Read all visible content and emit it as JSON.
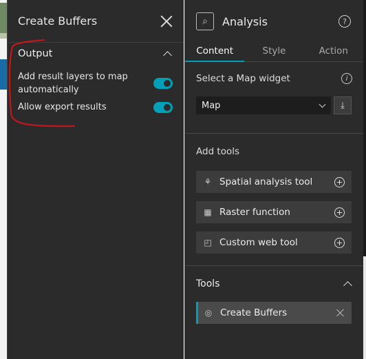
{
  "left_panel": {
    "title": "Create Buffers",
    "output_section": {
      "title": "Output",
      "options": [
        {
          "label": "Add result layers to map automatically",
          "enabled": true
        },
        {
          "label": "Allow export results",
          "enabled": true
        }
      ]
    }
  },
  "right_panel": {
    "title": "Analysis",
    "tabs": [
      "Content",
      "Style",
      "Action"
    ],
    "active_tab": "Content",
    "map_widget": {
      "label": "Select a Map widget",
      "selected": "Map"
    },
    "add_tools": {
      "title": "Add tools",
      "items": [
        {
          "label": "Spatial analysis tool",
          "icon": "spatial-analysis-icon"
        },
        {
          "label": "Raster function",
          "icon": "raster-function-icon"
        },
        {
          "label": "Custom web tool",
          "icon": "custom-web-tool-icon"
        }
      ]
    },
    "tools": {
      "title": "Tools",
      "items": [
        {
          "label": "Create Buffers",
          "icon": "buffer-tool-icon"
        }
      ]
    }
  },
  "colors": {
    "panel_bg": "#2b2b2b",
    "accent": "#00a0b8",
    "annotation": "#d0141c"
  }
}
